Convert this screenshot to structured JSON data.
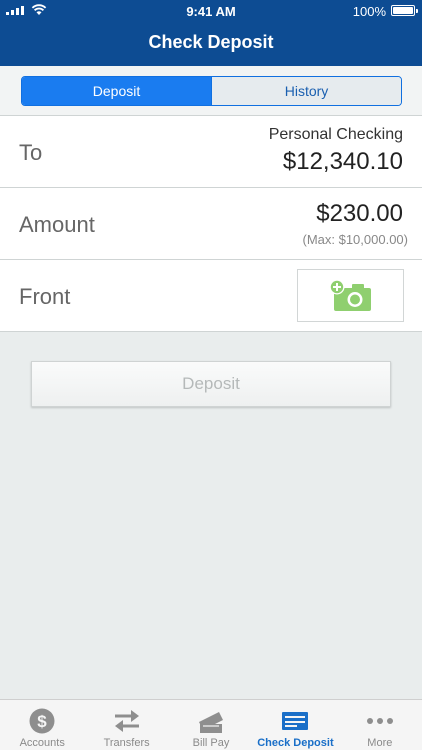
{
  "status_bar": {
    "time": "9:41 AM",
    "battery": "100%"
  },
  "header": {
    "title": "Check Deposit"
  },
  "segments": [
    {
      "label": "Deposit",
      "selected": true
    },
    {
      "label": "History",
      "selected": false
    }
  ],
  "form": {
    "to": {
      "label": "To",
      "account_name": "Personal Checking",
      "balance": "$12,340.10"
    },
    "amount": {
      "label": "Amount",
      "value": "$230.00",
      "max": "(Max: $10,000.00)"
    },
    "front": {
      "label": "Front",
      "icon": "add-camera-icon"
    }
  },
  "deposit_button": {
    "label": "Deposit",
    "enabled": false
  },
  "tabs": [
    {
      "label": "Accounts",
      "icon": "dollar-circle-icon"
    },
    {
      "label": "Transfers",
      "icon": "transfer-arrows-icon"
    },
    {
      "label": "Bill Pay",
      "icon": "bill-pay-icon"
    },
    {
      "label": "Check Deposit",
      "icon": "check-deposit-icon",
      "selected": true
    },
    {
      "label": "More",
      "icon": "more-dots-icon"
    }
  ],
  "colors": {
    "header": "#0d4c93",
    "accent": "#1a7cf0",
    "camera_green": "#8fcf6f",
    "tab_selected": "#1a6fc8"
  }
}
